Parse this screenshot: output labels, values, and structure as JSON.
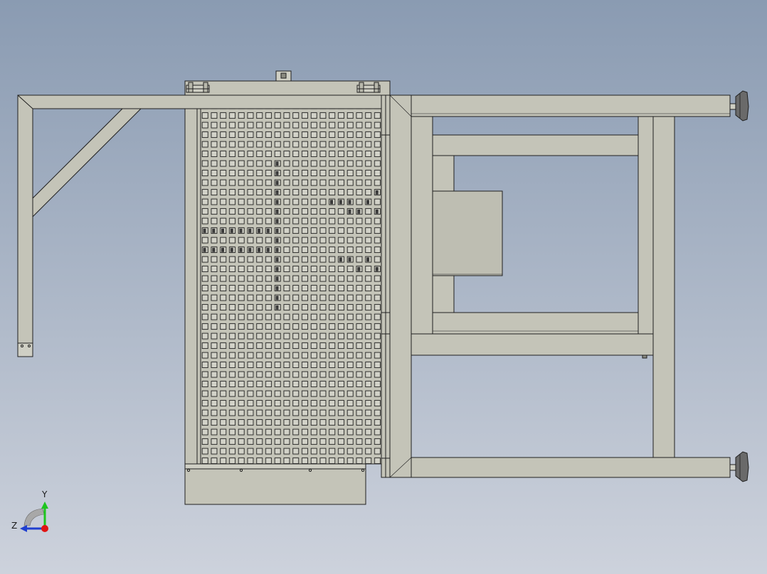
{
  "view": {
    "background_top": "#8a9bb2",
    "background_bottom": "#cdd2dc",
    "part_fill": "#c4c4b8",
    "part_fill_light": "#cfcfc4",
    "edge_color": "#1f1f1f",
    "foot_color": "#6a6a6a"
  },
  "triad": {
    "y_label": "Y",
    "z_label": "Z",
    "y_color": "#1ec51e",
    "z_color": "#1f3fd0",
    "x_color": "#e01414"
  }
}
